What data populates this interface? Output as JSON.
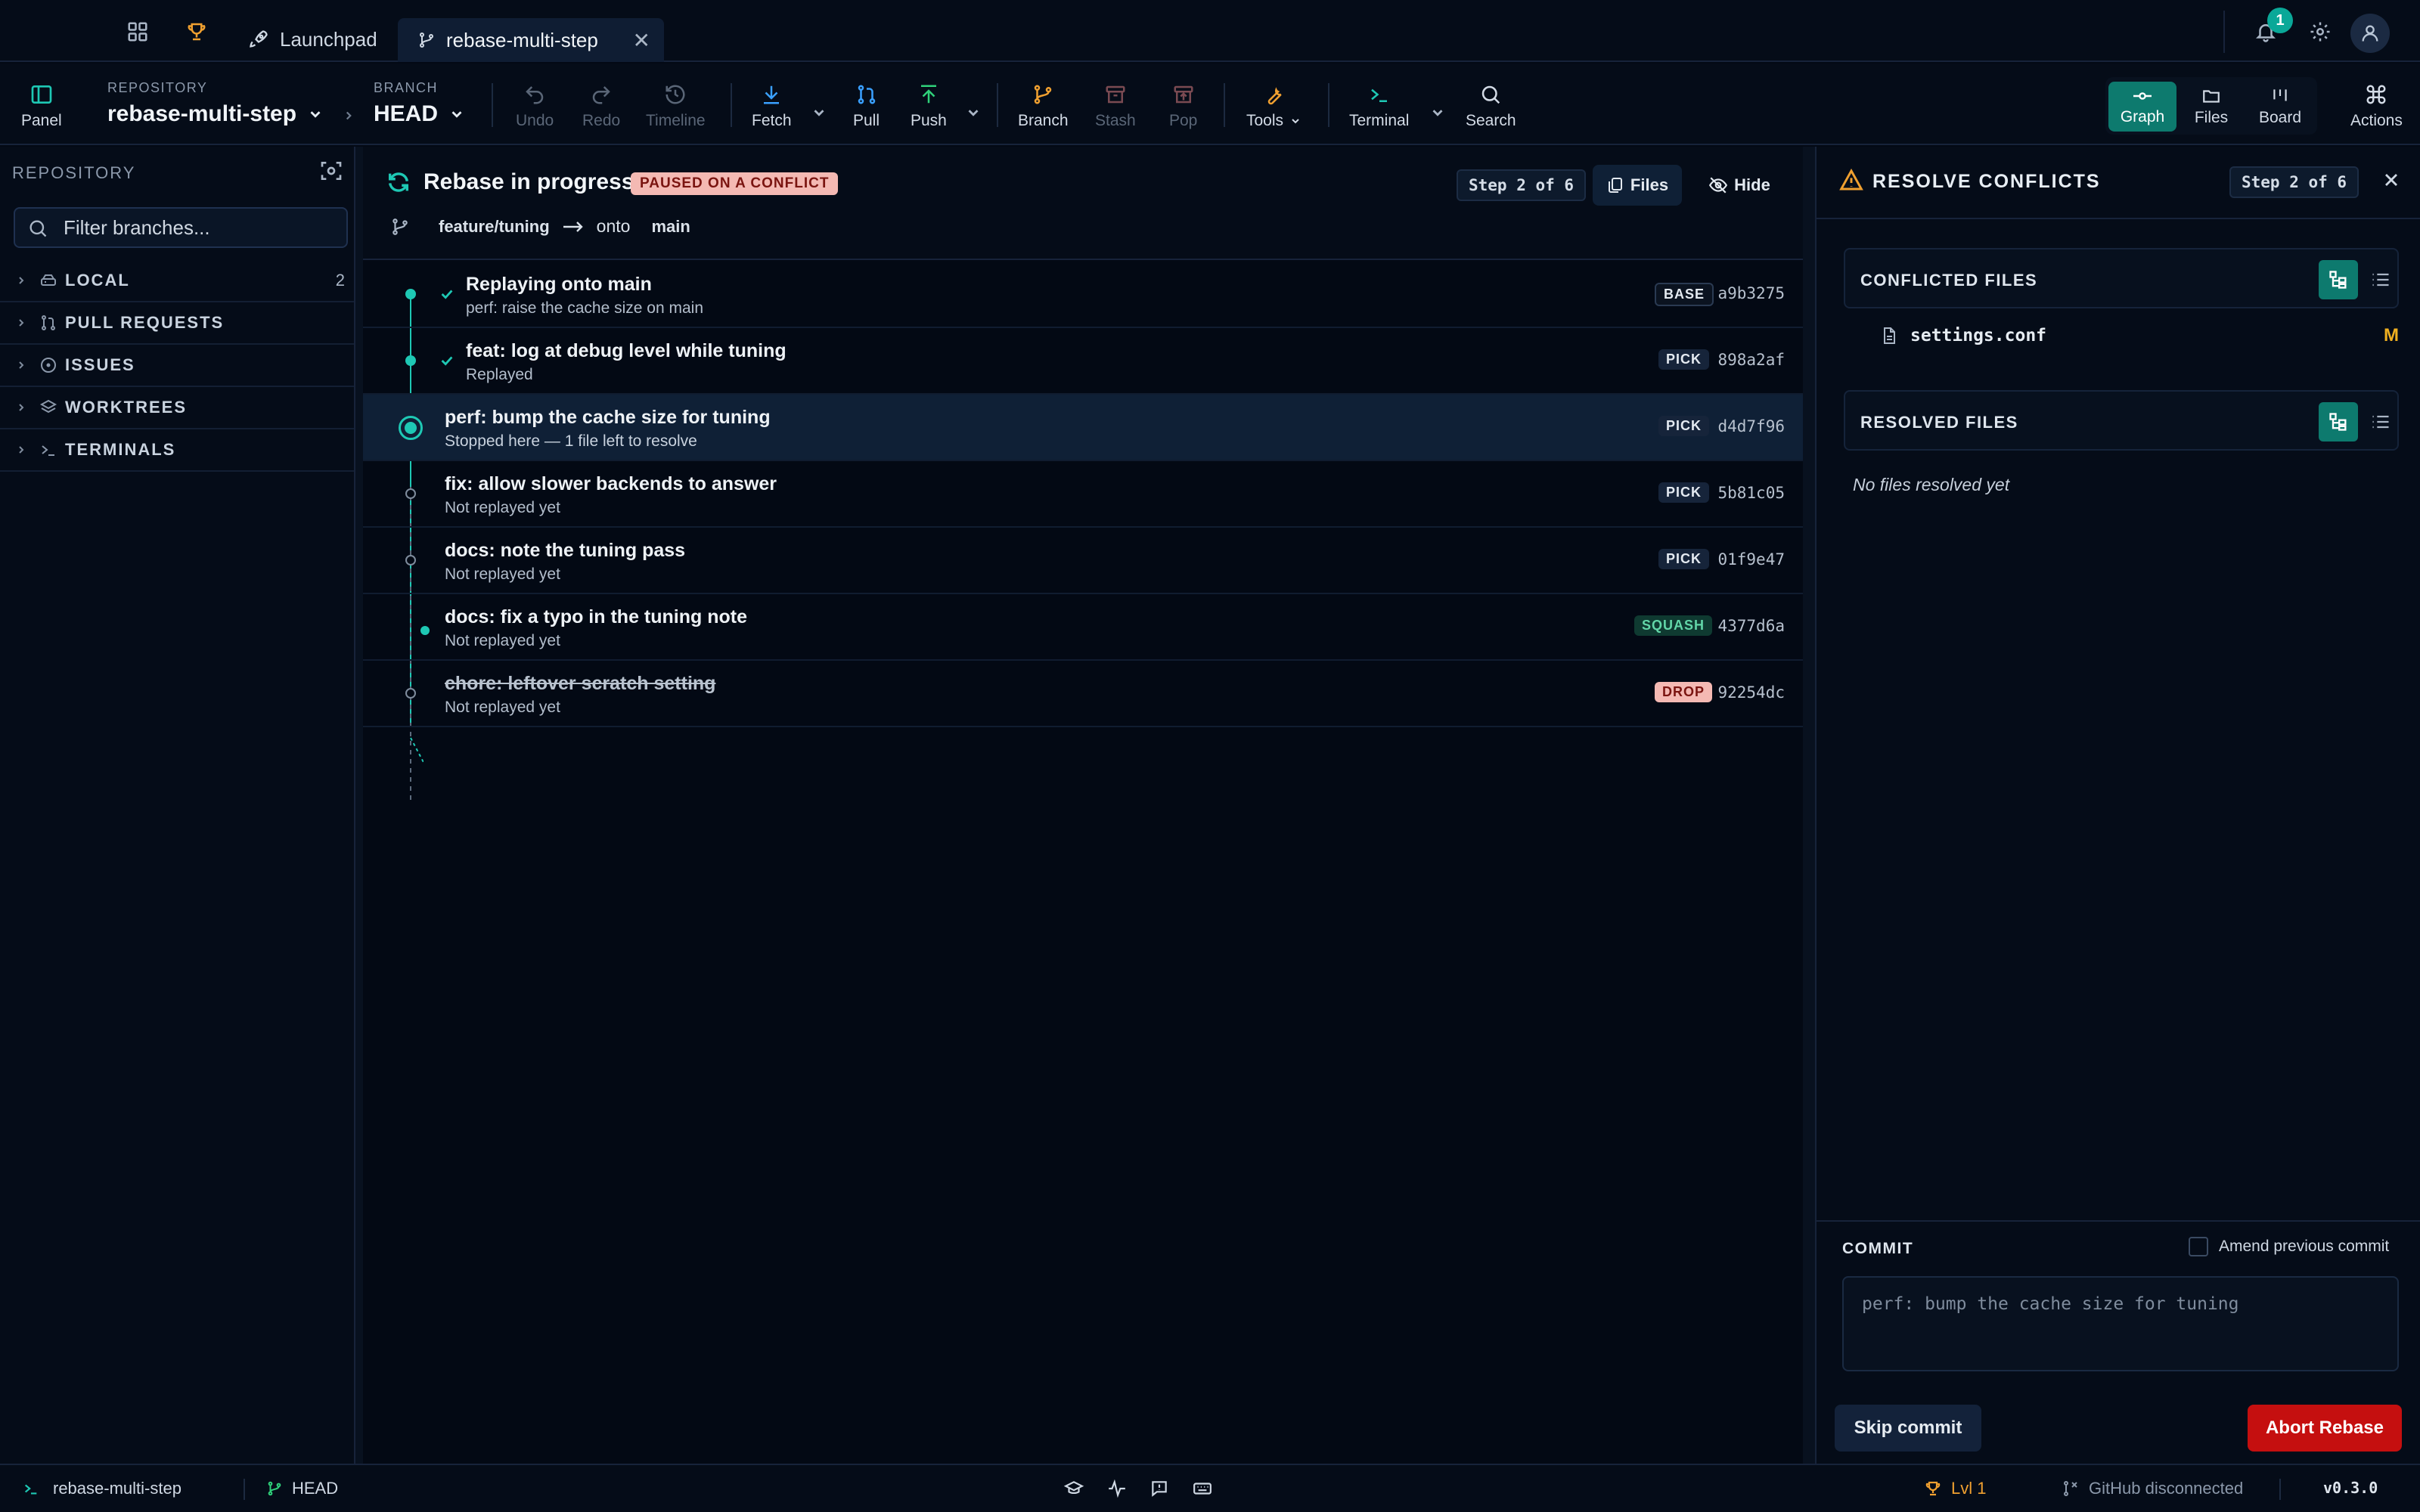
{
  "tabs": {
    "launchpad": "Launchpad",
    "active": "rebase-multi-step",
    "notification_count": "1"
  },
  "toolbar": {
    "panel": "Panel",
    "repo_label": "REPOSITORY",
    "repo_value": "rebase-multi-step",
    "branch_label": "BRANCH",
    "branch_value": "HEAD",
    "undo": "Undo",
    "redo": "Redo",
    "timeline": "Timeline",
    "fetch": "Fetch",
    "pull": "Pull",
    "push": "Push",
    "branch": "Branch",
    "stash": "Stash",
    "pop": "Pop",
    "tools": "Tools",
    "terminal": "Terminal",
    "search": "Search",
    "views": {
      "graph": "Graph",
      "files": "Files",
      "board": "Board"
    },
    "actions": "Actions"
  },
  "sidebar": {
    "title": "REPOSITORY",
    "filter_placeholder": "Filter branches...",
    "items": [
      {
        "label": "LOCAL",
        "count": "2"
      },
      {
        "label": "PULL REQUESTS",
        "count": ""
      },
      {
        "label": "ISSUES",
        "count": ""
      },
      {
        "label": "WORKTREES",
        "count": ""
      },
      {
        "label": "TERMINALS",
        "count": ""
      }
    ]
  },
  "rebase": {
    "title": "Rebase in progress",
    "badge": "PAUSED ON A CONFLICT",
    "step": "Step 2 of 6",
    "files_btn": "Files",
    "hide_btn": "Hide",
    "source_branch": "feature/tuning",
    "onto_label": "onto",
    "target_branch": "main",
    "commits": [
      {
        "title": "Replaying onto main",
        "subtitle": "perf: raise the cache size on main",
        "tag": "BASE",
        "hash": "a9b3275"
      },
      {
        "title": "feat: log at debug level while tuning",
        "subtitle": "Replayed",
        "tag": "PICK",
        "hash": "898a2af"
      },
      {
        "title": "perf: bump the cache size for tuning",
        "subtitle": "Stopped here — 1 file left to resolve",
        "tag": "PICK",
        "hash": "d4d7f96"
      },
      {
        "title": "fix: allow slower backends to answer",
        "subtitle": "Not replayed yet",
        "tag": "PICK",
        "hash": "5b81c05"
      },
      {
        "title": "docs: note the tuning pass",
        "subtitle": "Not replayed yet",
        "tag": "PICK",
        "hash": "01f9e47"
      },
      {
        "title": "docs: fix a typo in the tuning note",
        "subtitle": "Not replayed yet",
        "tag": "SQUASH",
        "hash": "4377d6a"
      },
      {
        "title": "chore: leftover scratch setting",
        "subtitle": "Not replayed yet",
        "tag": "DROP",
        "hash": "92254dc"
      }
    ]
  },
  "conflicts": {
    "title": "RESOLVE CONFLICTS",
    "step": "Step 2 of 6",
    "conflicted_header": "CONFLICTED FILES",
    "file_name": "settings.conf",
    "file_status": "M",
    "resolved_header": "RESOLVED FILES",
    "no_resolved": "No files resolved yet",
    "commit_label": "COMMIT",
    "amend_label": "Amend previous commit",
    "commit_message": "perf: bump the cache size for tuning",
    "skip": "Skip commit",
    "abort": "Abort Rebase"
  },
  "status": {
    "repo": "rebase-multi-step",
    "branch": "HEAD",
    "level": "Lvl 1",
    "github": "GitHub disconnected",
    "version": "v0.3.0"
  },
  "colors": {
    "accent": "#0d7a6e",
    "danger": "#c50f0f",
    "node": "#1ec8b4"
  }
}
